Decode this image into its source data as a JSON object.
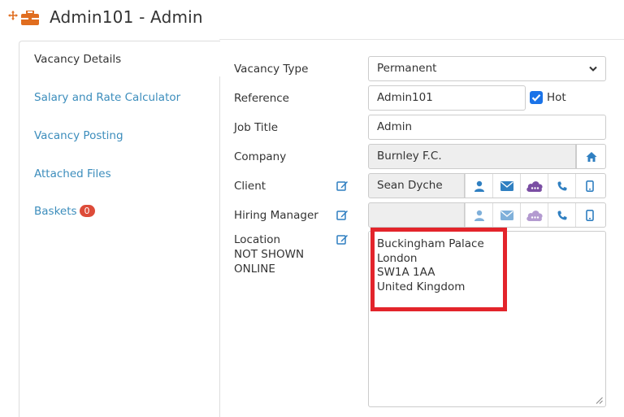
{
  "header": {
    "title": "Admin101 - Admin",
    "move_icon": "move-arrows-icon",
    "briefcase_icon": "briefcase-icon",
    "icon_color": "#e06d1f"
  },
  "tabs": [
    {
      "label": "Vacancy Details",
      "active": true
    },
    {
      "label": "Salary and Rate Calculator",
      "active": false
    },
    {
      "label": "Vacancy Posting",
      "active": false
    },
    {
      "label": "Attached Files",
      "active": false
    },
    {
      "label": "Baskets",
      "active": false,
      "badge": "0"
    }
  ],
  "form": {
    "vacancy_type": {
      "label": "Vacancy Type",
      "value": "Permanent"
    },
    "reference": {
      "label": "Reference",
      "value": "Admin101",
      "hot_label": "Hot",
      "hot_checked": true
    },
    "job_title": {
      "label": "Job Title",
      "value": "Admin"
    },
    "company": {
      "label": "Company",
      "value": "Burnley F.C.",
      "icon": "home-icon"
    },
    "client": {
      "label": "Client",
      "value": "Sean Dyche"
    },
    "hiring_manager": {
      "label": "Hiring Manager",
      "value": ""
    },
    "location": {
      "label_line1": "Location",
      "label_line2": "NOT SHOWN",
      "label_line3": "ONLINE",
      "address": [
        "Buckingham Palace",
        "London",
        "SW1A 1AA",
        "United Kingdom"
      ]
    }
  },
  "contact_icons": [
    "user-icon",
    "envelope-icon",
    "cloud-chat-icon",
    "phone-icon",
    "mobile-icon"
  ],
  "colors": {
    "link": "#3c8dbc",
    "icon_blue": "#2f7fc1",
    "icon_purple": "#7a4ea3",
    "badge": "#dd4b39",
    "highlight": "#e3242b",
    "checkbox": "#1a73e8"
  }
}
